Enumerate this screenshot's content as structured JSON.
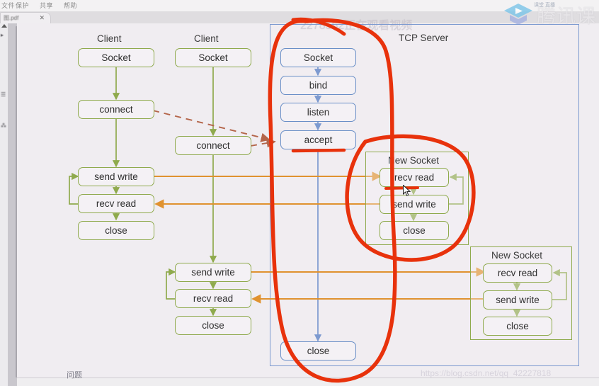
{
  "app": {
    "menu_items": [
      "文件",
      "保护",
      "共享",
      "帮助"
    ],
    "tab_label": "图.pdf",
    "tab_close_icon": "close-icon",
    "rail_glyphs": [
      "▸",
      "☰",
      "⁂"
    ],
    "bottom_left_note": "问题"
  },
  "watermarks": {
    "brand_text": "腾讯课",
    "brand_sub_text": "课堂 直播",
    "viewer_count": "2278562正在观看视频",
    "csdn_url": "https://blog.csdn.net/qq_42227818"
  },
  "diagram": {
    "client_columns": [
      {
        "title": "Client",
        "nodes": [
          "Socket",
          "connect",
          "send write",
          "recv read",
          "close"
        ]
      },
      {
        "title": "Client",
        "nodes": [
          "Socket",
          "connect",
          "send write",
          "recv read",
          "close"
        ]
      }
    ],
    "server": {
      "title": "TCP Server",
      "nodes": [
        "Socket",
        "bind",
        "listen",
        "accept",
        "close"
      ],
      "new_sockets": [
        {
          "title": "New Socket",
          "nodes": [
            "recv read",
            "send write",
            "close"
          ]
        },
        {
          "title": "New Socket",
          "nodes": [
            "recv read",
            "send write",
            "close"
          ]
        }
      ]
    },
    "colors": {
      "client_border": "#8faa4d",
      "server_border": "#6a8fc7",
      "data_arrow": "#e0922f",
      "dashed_arrow": "#b4654a",
      "annotation": "#e8320c",
      "page_background": "#f0edf1"
    }
  }
}
